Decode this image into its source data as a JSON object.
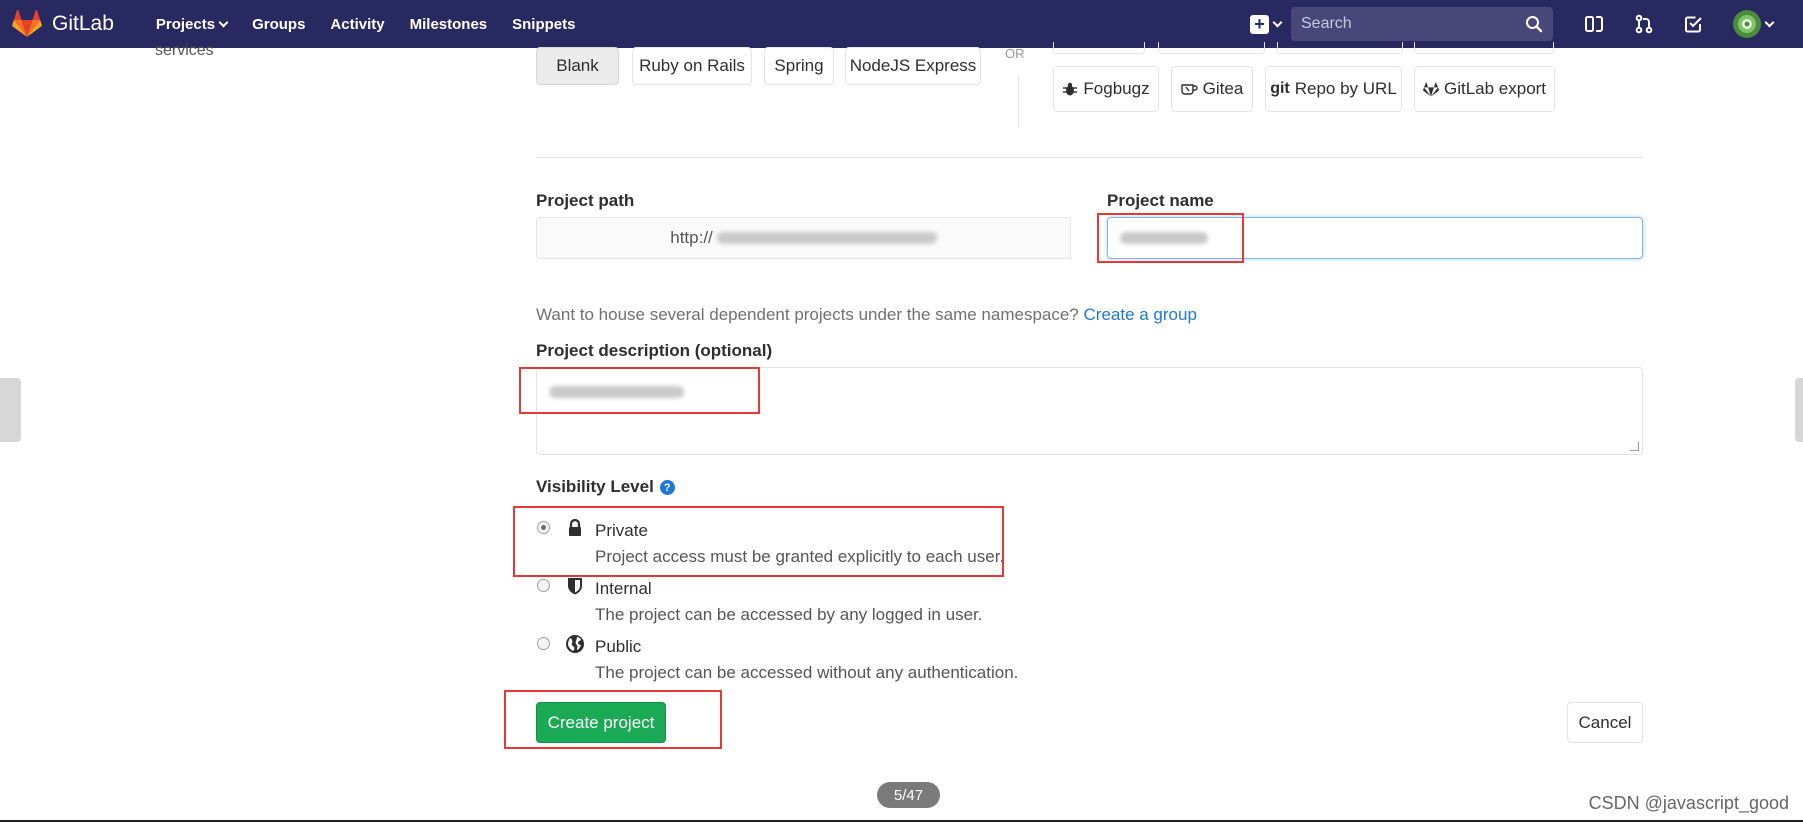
{
  "navbar": {
    "brand": "GitLab",
    "links": [
      {
        "label": "Projects",
        "dropdown": true
      },
      {
        "label": "Groups",
        "dropdown": false
      },
      {
        "label": "Activity",
        "dropdown": false
      },
      {
        "label": "Milestones",
        "dropdown": false
      },
      {
        "label": "Snippets",
        "dropdown": false
      }
    ],
    "search_placeholder": "Search",
    "colors": {
      "background": "#292961",
      "search_bg": "#47477a"
    }
  },
  "sidebar": {
    "partial_text": "services"
  },
  "templates": {
    "items": [
      "Blank",
      "Ruby on Rails",
      "Spring",
      "NodeJS Express"
    ],
    "selected": "Blank"
  },
  "import": {
    "or_label": "OR",
    "items": [
      {
        "label": "Fogbugz",
        "icon": "bug-icon"
      },
      {
        "label": "Gitea",
        "icon": "gitea-icon"
      },
      {
        "label": "Repo by URL",
        "icon": "git-icon",
        "prefix": "git"
      },
      {
        "label": "GitLab export",
        "icon": "gitlab-icon"
      }
    ]
  },
  "form": {
    "project_path_label": "Project path",
    "project_path_value": "http://",
    "project_name_label": "Project name",
    "project_name_value": "",
    "hint_text": "Want to house several dependent projects under the same namespace? ",
    "hint_link": "Create a group",
    "description_label": "Project description (optional)",
    "description_value": "",
    "visibility_label": "Visibility Level",
    "visibility_options": [
      {
        "title": "Private",
        "desc": "Project access must be granted explicitly to each user.",
        "icon": "lock-icon",
        "checked": true
      },
      {
        "title": "Internal",
        "desc": "The project can be accessed by any logged in user.",
        "icon": "shield-icon",
        "checked": false
      },
      {
        "title": "Public",
        "desc": "The project can be accessed without any authentication.",
        "icon": "globe-icon",
        "checked": false
      }
    ],
    "create_button": "Create project",
    "cancel_button": "Cancel",
    "accent_color": "#1aaa55",
    "link_color": "#1f78d1"
  },
  "overlay": {
    "page_indicator": "5/47",
    "watermark": "CSDN @javascript_good",
    "annotation_color": "#e53935"
  }
}
